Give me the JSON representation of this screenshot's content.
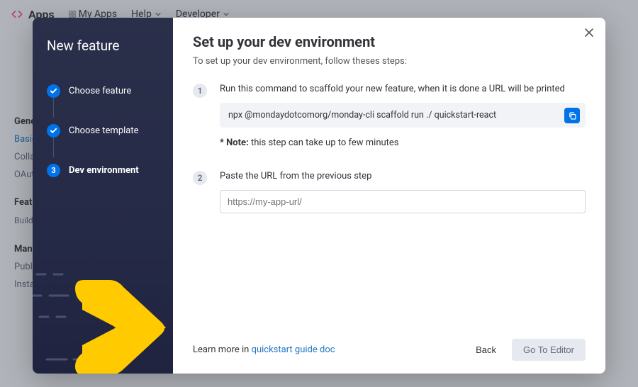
{
  "bg": {
    "brand": "Apps",
    "nav": [
      "My Apps",
      "Help",
      "Developer"
    ],
    "general_title": "General",
    "general_items": [
      "Basic Information",
      "Collaborators",
      "OAuth"
    ],
    "features_title": "Features",
    "features_desc": "Build your own views, widgets, integrations & automations",
    "manage_title": "Manage",
    "manage_items": [
      "Publish",
      "Install"
    ]
  },
  "modal": {
    "sidebar_title": "New feature",
    "steps": [
      {
        "label": "Choose feature",
        "done": true
      },
      {
        "label": "Choose template",
        "done": true
      },
      {
        "label": "Dev environment",
        "active": true,
        "num": "3"
      }
    ],
    "title": "Set up your dev environment",
    "subtitle": "To set up your dev environment, follow theses steps:",
    "step1": {
      "num": "1",
      "text": "Run this command to scaffold your new feature, when it is done a URL will be printed",
      "code": "npx @mondaydotcomorg/monday-cli scaffold run ./ quickstart-react",
      "note_label": "* Note:",
      "note_text": "this step can take up to few minutes"
    },
    "step2": {
      "num": "2",
      "text": "Paste the URL from the previous step",
      "placeholder": "https://my-app-url/"
    },
    "learn_prefix": "Learn more in ",
    "learn_link": "quickstart guide doc",
    "back": "Back",
    "go": "Go To Editor"
  }
}
